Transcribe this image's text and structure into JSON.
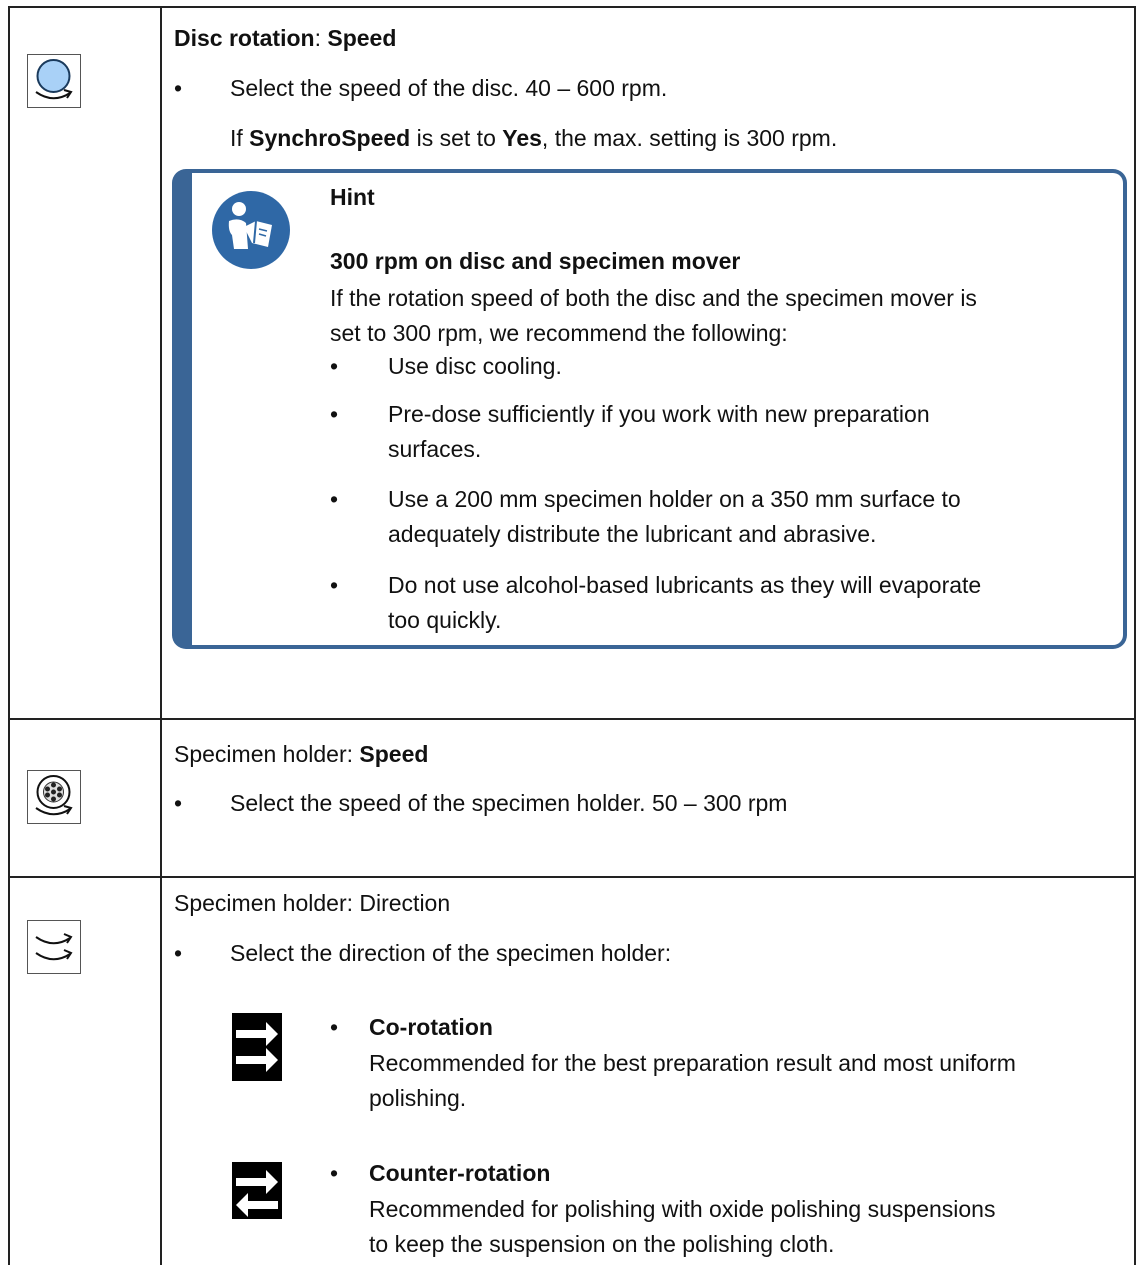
{
  "rows": [
    {
      "icon": "disc-rotation-speed-icon",
      "heading": {
        "part1": "Disc rotation",
        "sep": ": ",
        "part2": "Speed"
      },
      "bullet": "Select the speed of the disc. 40 – 600 rpm.",
      "note": {
        "pre": "If ",
        "b1": "SynchroSpeed",
        "mid": " is set to ",
        "b2": "Yes",
        "post": ", the max. setting is 300 rpm."
      },
      "hint": {
        "icon": "read-manual-icon",
        "label": "Hint",
        "title": "300 rpm on disc and specimen mover",
        "intro_line1": "If the rotation speed of both the disc and the specimen mover is",
        "intro_line2": "set to 300 rpm, we recommend the following:",
        "items": [
          [
            "Use disc cooling."
          ],
          [
            "Pre-dose sufficiently if you work with new preparation",
            "surfaces."
          ],
          [
            "Use a 200 mm specimen holder on a 350 mm surface to",
            "adequately distribute the lubricant and abrasive."
          ],
          [
            "Do not use alcohol-based lubricants as they will evaporate",
            "too quickly."
          ]
        ]
      }
    },
    {
      "icon": "specimen-holder-speed-icon",
      "heading": {
        "part1": "Specimen holder: ",
        "part2": "Speed"
      },
      "bullet": "Select the speed of the specimen holder. 50 – 300 rpm"
    },
    {
      "icon": "specimen-holder-direction-icon",
      "heading": {
        "part1": "Specimen holder: Direction"
      },
      "bullet": "Select the direction of the specimen holder:",
      "options": [
        {
          "icon": "co-rotation-arrows-icon",
          "title": "Co-rotation",
          "lines": [
            "Recommended for the best preparation result and most uniform",
            "polishing."
          ]
        },
        {
          "icon": "counter-rotation-arrows-icon",
          "title": "Counter-rotation",
          "lines": [
            "Recommended for polishing with oxide polishing suspensions",
            "to keep the suspension on the polishing cloth."
          ]
        }
      ]
    }
  ]
}
